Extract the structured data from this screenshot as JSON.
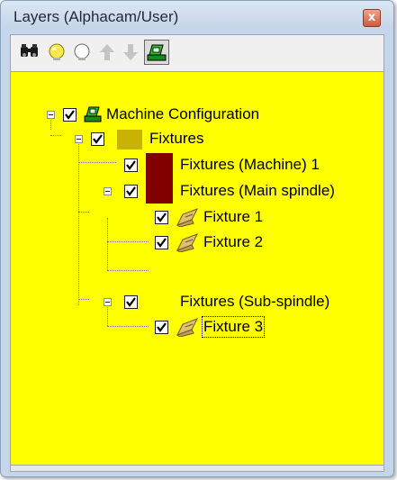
{
  "window": {
    "title": "Layers (Alphacam/User)",
    "close_glyph": "x"
  },
  "toolbar": {
    "buttons": [
      {
        "icon": "binoculars-icon"
      },
      {
        "icon": "bulb-on-icon"
      },
      {
        "icon": "bulb-off-icon"
      },
      {
        "icon": "arrow-up-icon",
        "enabled": false
      },
      {
        "icon": "arrow-down-icon",
        "enabled": false
      },
      {
        "icon": "machine-config-icon",
        "pressed": true
      }
    ]
  },
  "tree": {
    "background": "#ffff00",
    "nodes": {
      "machine_config": {
        "label": "Machine Configuration",
        "checked": true,
        "expanded": true
      },
      "fixtures": {
        "label": "Fixtures",
        "checked": true,
        "expanded": true,
        "color": "#c8b400"
      },
      "fixtures_machine": {
        "label": "Fixtures (Machine) 1",
        "checked": true,
        "color": "#800000"
      },
      "fixtures_main": {
        "label": "Fixtures (Main spindle)",
        "checked": true,
        "expanded": true,
        "color": "#800000"
      },
      "fixture1": {
        "label": "Fixture 1",
        "checked": true,
        "icon": "fixture-icon"
      },
      "fixture2": {
        "label": "Fixture 2",
        "checked": true,
        "icon": "fixture-icon"
      },
      "fixtures_sub": {
        "label": "Fixtures (Sub-spindle)",
        "checked": true,
        "expanded": true
      },
      "fixture3": {
        "label": "Fixture 3",
        "checked": true,
        "icon": "fixture-icon",
        "selected": true
      }
    }
  }
}
